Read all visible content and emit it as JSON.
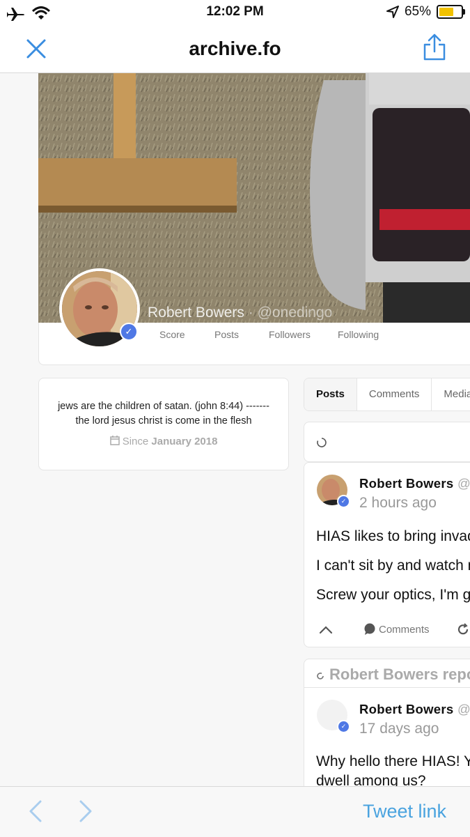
{
  "status_bar": {
    "time": "12:02 PM",
    "battery": "65%",
    "battery_level": 0.65
  },
  "nav": {
    "title": "archive.fo"
  },
  "profile": {
    "name": "Robert Bowers",
    "separator": " · ",
    "handle": "@onedingo",
    "stats": [
      "Score",
      "Posts",
      "Followers",
      "Following"
    ]
  },
  "bio": {
    "text": "jews are the children of satan. (john 8:44) ------- the lord jesus christ is come in the flesh",
    "since_prefix": "Since",
    "since_date": "January 2018"
  },
  "tabs": [
    "Posts",
    "Comments",
    "Media"
  ],
  "post1": {
    "author": "Robert Bowers",
    "at": "@",
    "time": "2 hours ago",
    "lines": [
      "HIAS likes to bring invaders",
      "I can't sit by and watch my",
      "Screw your optics, I'm going in."
    ],
    "comments_label": "Comments"
  },
  "repost_header": "Robert Bowers reposted",
  "post2": {
    "author": "Robert Bowers",
    "at": "@",
    "time": "17 days ago",
    "lines": [
      "Why hello there HIAS! You like",
      "dwell among us?"
    ]
  },
  "toolbar": {
    "tweet_link": "Tweet link"
  }
}
